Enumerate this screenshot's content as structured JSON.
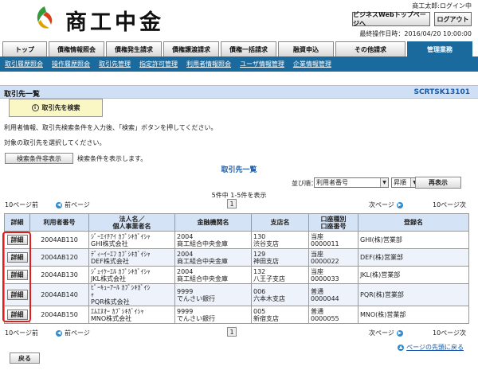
{
  "header": {
    "logo_text": "商工中金",
    "user_info": "商工太郎:ログイン中",
    "biz_top_button": "ビジネスWebトップページへ",
    "logout_button": "ログアウト",
    "last_operation": "最終操作日時：2016/04/20 10:00:00"
  },
  "tabs": [
    "トップ",
    "債権情報照会",
    "債権発生請求",
    "債権譲渡請求",
    "債権一括請求",
    "融資申込",
    "その他請求",
    "管理業務"
  ],
  "subnav": [
    "取引履歴照会",
    "操作履歴照会",
    "取引先管理",
    "指定許可管理",
    "利用者情報照会",
    "ユーザ情報管理",
    "企業情報管理"
  ],
  "page": {
    "title": "取引先一覧",
    "screen_id": "SCRTSK13101",
    "search_button": "取引先を検索",
    "instruction1": "利用者情報、取引先検索条件を入力後、「検索」ボタンを押してください。",
    "instruction2": "対象の取引先を選択してください。",
    "toggle_button": "検索条件非表示",
    "toggle_note": "検索条件を表示します。",
    "list_title": "取引先一覧",
    "sort_label": "並び順：",
    "sort_value": "利用者番号",
    "order_value": "昇順",
    "redisplay_button": "再表示",
    "count_text": "5件中 1-5件を表示",
    "prev10": "10ページ前",
    "prev": "前ページ",
    "page_number": "1",
    "next": "次ページ",
    "next10": "10ページ次",
    "to_top": "ページの先頭に戻る",
    "back_button": "戻る"
  },
  "table": {
    "headers": [
      "詳細",
      "利用者番号",
      "法人名／\n個人事業者名",
      "金融機関名",
      "支店名",
      "口座種別\n口座番号",
      "登録名"
    ],
    "detail_label": "詳細",
    "rows": [
      {
        "user": "2004AB110",
        "name": "ｼﾞｰｴｲﾁｱｲ ｶﾌﾞｼｷｶﾞｲｼｬ\nGHI株式会社",
        "bank": "2004\n商工組合中央金庫",
        "branch": "130\n渋谷支店",
        "account": "当座\n0000011",
        "reg": "GHI(株)営業部"
      },
      {
        "user": "2004AB120",
        "name": "ﾃﾞｨｰｲｰｴﾌ ｶﾌﾞｼｷｶﾞｲｼｬ\nDEF株式会社",
        "bank": "2004\n商工組合中央金庫",
        "branch": "129\n神田支店",
        "account": "当座\n0000022",
        "reg": "DEF(株)営業部"
      },
      {
        "user": "2004AB130",
        "name": "ｼﾞｪｲｹｰｴﾙ ｶﾌﾞｼｷｶﾞｲｼｬ\nJKL株式会社",
        "bank": "2004\n商工組合中央金庫",
        "branch": "132\n八王子支店",
        "account": "当座\n0000033",
        "reg": "JKL(株)営業部"
      },
      {
        "user": "2004AB140",
        "name": "ﾋﾟｰｷｭｰｱｰﾙ ｶﾌﾞｼｷｶﾞｲｼ\nｬ\nPQR株式会社",
        "bank": "9999\nでんさい銀行",
        "branch": "006\n六本木支店",
        "account": "普通\n0000044",
        "reg": "PQR(株)営業部"
      },
      {
        "user": "2004AB150",
        "name": "ｴﾑｴﾇｵｰ ｶﾌﾞｼｷｶﾞｲｼｬ\nMNO株式会社",
        "bank": "9999\nでんさい銀行",
        "branch": "005\n新宿支店",
        "account": "普通\n0000055",
        "reg": "MNO(株)営業部"
      }
    ]
  },
  "colors": {
    "nav_blue": "#1a6a9e",
    "header_blue": "#d4e3f6",
    "highlight_red": "#e21d1d",
    "search_yellow": "#fbf7c5"
  }
}
